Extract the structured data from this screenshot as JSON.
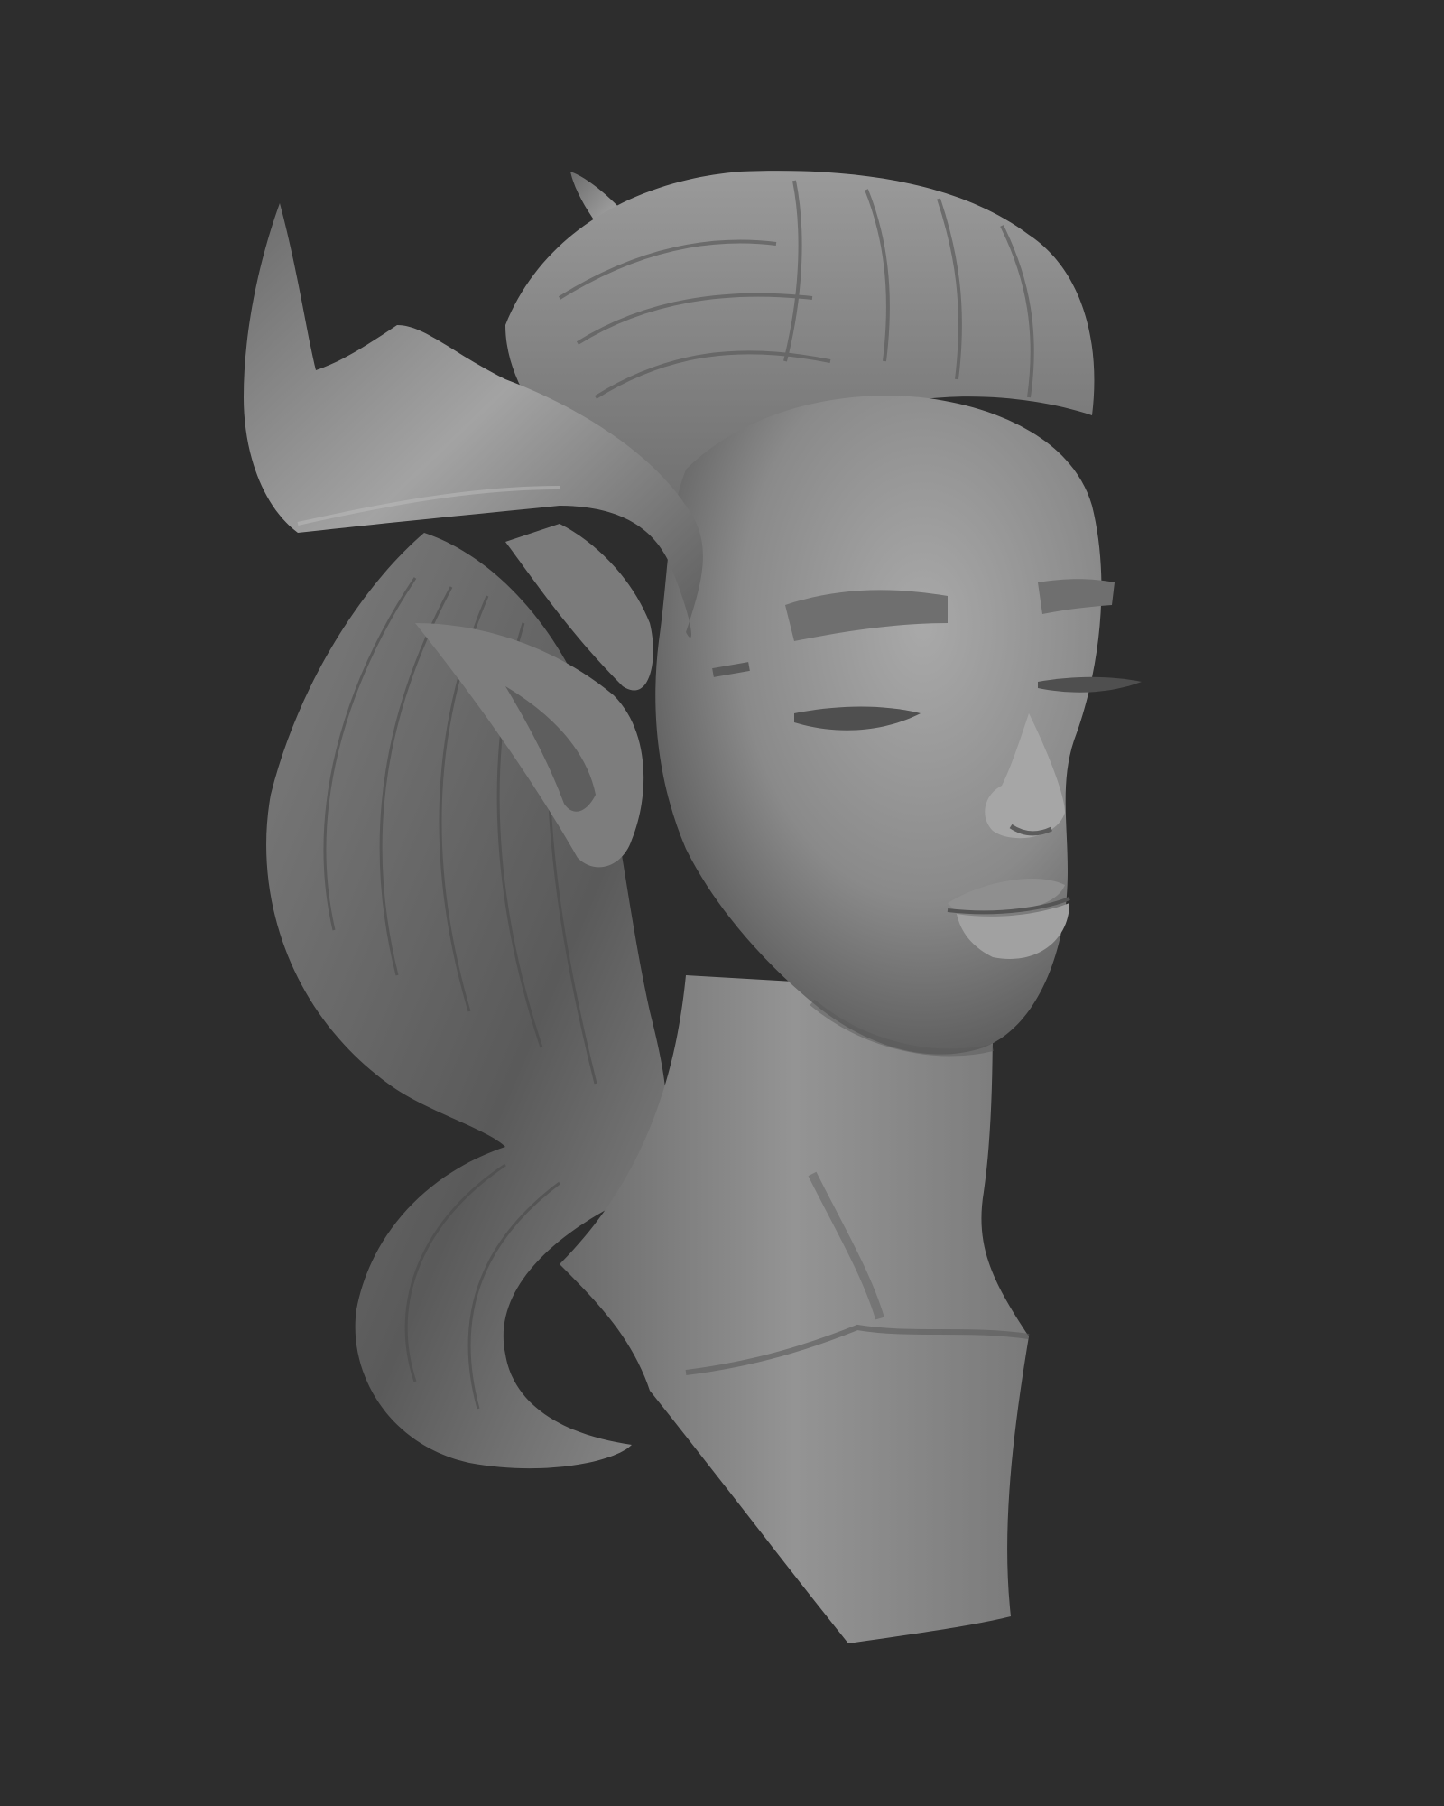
{
  "viewport": {
    "background_color": "#2d2d2d",
    "material_color": "#8c8c8c"
  },
  "subject": {
    "name": "sculpted-bust",
    "parts": [
      "horn-left",
      "horn-back",
      "hair",
      "ponytail",
      "pointed-ear",
      "face",
      "neck",
      "chest-cut"
    ]
  }
}
